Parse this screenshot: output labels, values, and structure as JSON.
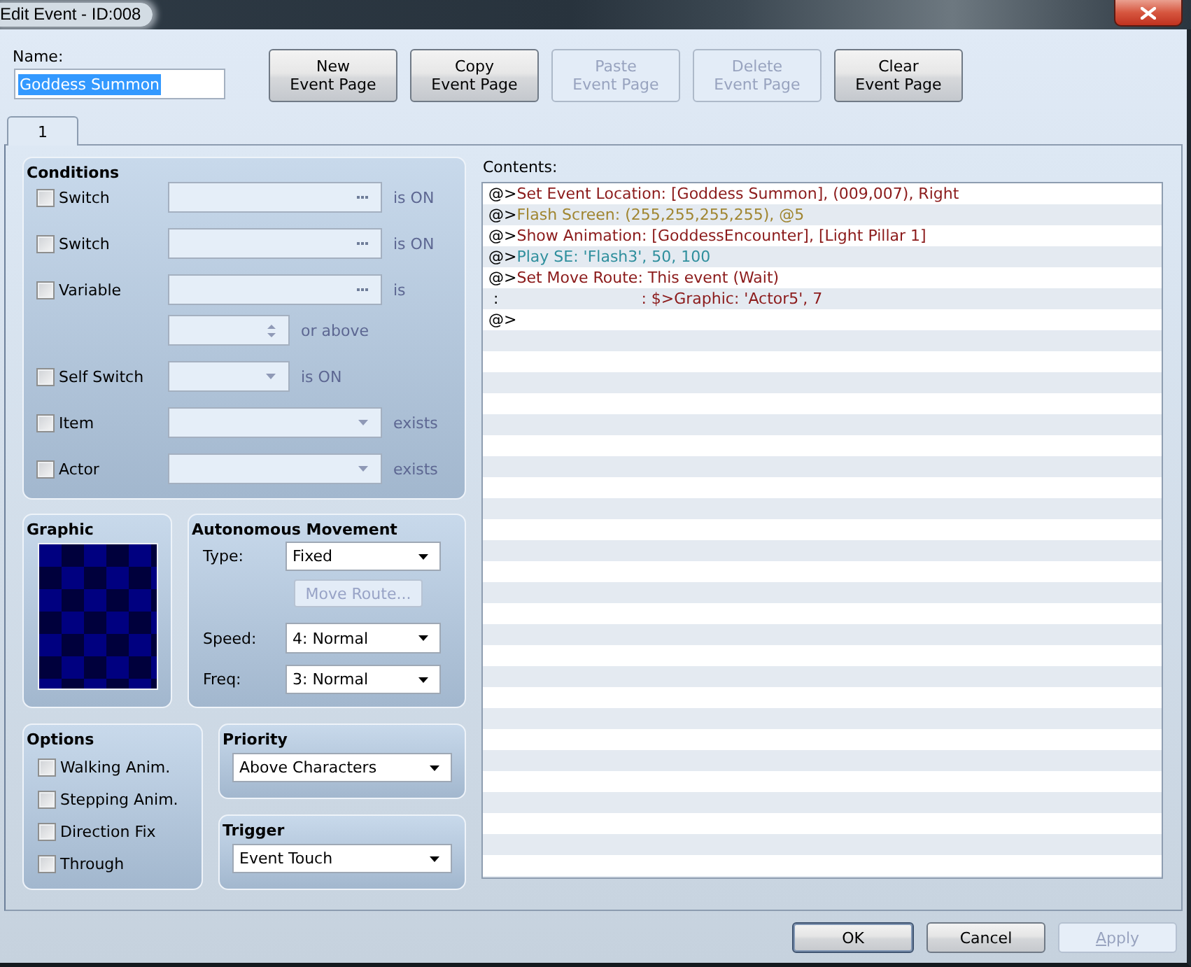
{
  "window": {
    "title": "Edit Event - ID:008"
  },
  "name_field": {
    "label": "Name:",
    "value": "Goddess Summon",
    "text_selected": true
  },
  "page_buttons": [
    {
      "label": "New\nEvent Page",
      "disabled": false
    },
    {
      "label": "Copy\nEvent Page",
      "disabled": false
    },
    {
      "label": "Paste\nEvent Page",
      "disabled": true
    },
    {
      "label": "Delete\nEvent Page",
      "disabled": true
    },
    {
      "label": "Clear\nEvent Page",
      "disabled": false
    }
  ],
  "tabs": [
    {
      "label": "1",
      "selected": true
    }
  ],
  "conditions": {
    "title": "Conditions",
    "items": [
      {
        "kind": "picker",
        "label": "Switch",
        "checked": false,
        "suffix": "is ON"
      },
      {
        "kind": "picker",
        "label": "Switch",
        "checked": false,
        "suffix": "is ON"
      },
      {
        "kind": "picker",
        "label": "Variable",
        "checked": false,
        "suffix": "is",
        "threshold": {
          "suffix": "or above"
        }
      },
      {
        "kind": "short-dropdown",
        "label": "Self Switch",
        "checked": false,
        "suffix": "is ON"
      },
      {
        "kind": "dropdown",
        "label": "Item",
        "checked": false,
        "suffix": "exists"
      },
      {
        "kind": "dropdown",
        "label": "Actor",
        "checked": false,
        "suffix": "exists"
      }
    ]
  },
  "graphic": {
    "title": "Graphic"
  },
  "movement": {
    "title": "Autonomous Movement",
    "type": {
      "label": "Type:",
      "value": "Fixed"
    },
    "move_route": {
      "label": "Move Route...",
      "disabled": true
    },
    "speed": {
      "label": "Speed:",
      "value": "4: Normal"
    },
    "freq": {
      "label": "Freq:",
      "value": "3: Normal"
    }
  },
  "options": {
    "title": "Options",
    "items": [
      {
        "label": "Walking Anim.",
        "checked": false
      },
      {
        "label": "Stepping Anim.",
        "checked": false
      },
      {
        "label": "Direction Fix",
        "checked": false
      },
      {
        "label": "Through",
        "checked": false
      }
    ]
  },
  "priority": {
    "title": "Priority",
    "value": "Above Characters"
  },
  "trigger": {
    "title": "Trigger",
    "value": "Event Touch"
  },
  "contents": {
    "label": "Contents:",
    "lines": [
      {
        "kind": "command",
        "prefix": "@>",
        "text": "Set Event Location: [Goddess Summon], (009,007), Right",
        "color": "#8b1a1a"
      },
      {
        "kind": "command",
        "prefix": "@>",
        "text": "Flash Screen: (255,255,255,255), @5",
        "color": "#a08530"
      },
      {
        "kind": "command",
        "prefix": "@>",
        "text": "Show Animation: [GoddessEncounter], [Light Pillar 1]",
        "color": "#8b1a1a"
      },
      {
        "kind": "command",
        "prefix": "@>",
        "text": "Play SE: 'Flash3', 50, 100",
        "color": "#2f8f9d"
      },
      {
        "kind": "command",
        "prefix": "@>",
        "text": "Set Move Route: This event (Wait)",
        "color": "#8b1a1a"
      },
      {
        "kind": "continuation",
        "prefix": " :",
        "text": ": $>Graphic: 'Actor5', 7",
        "color": "#8b1a1a"
      },
      {
        "kind": "command",
        "prefix": "@>"
      }
    ]
  },
  "footer_buttons": [
    {
      "label": "OK",
      "default": true,
      "disabled": false,
      "underline_first": false
    },
    {
      "label": "Cancel",
      "default": false,
      "disabled": false,
      "underline_first": false
    },
    {
      "label": "Apply",
      "default": false,
      "disabled": true,
      "underline_first": true
    }
  ]
}
